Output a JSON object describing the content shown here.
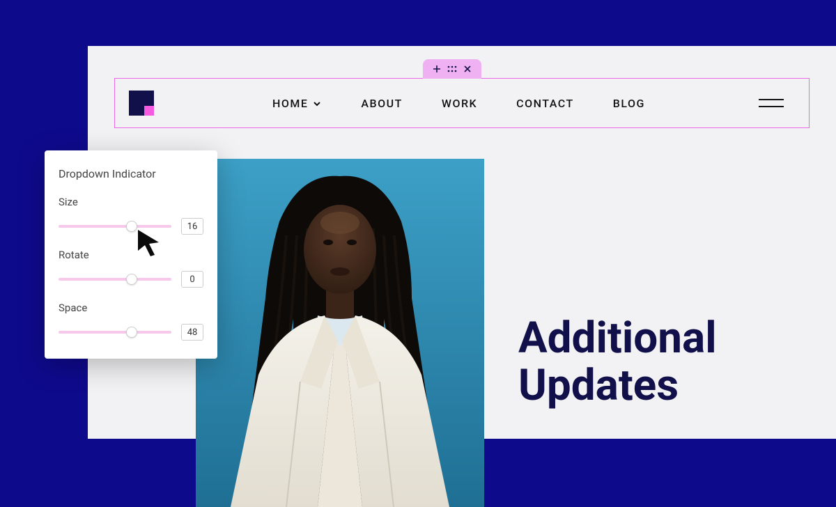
{
  "nav": {
    "items": [
      "HOME",
      "ABOUT",
      "WORK",
      "CONTACT",
      "BLOG"
    ]
  },
  "headline": {
    "line1": "Additional",
    "line2": "Updates"
  },
  "panel": {
    "title": "Dropdown Indicator",
    "controls": [
      {
        "label": "Size",
        "value": "16",
        "pos": 65
      },
      {
        "label": "Rotate",
        "value": "0",
        "pos": 65
      },
      {
        "label": "Space",
        "value": "48",
        "pos": 65
      }
    ]
  },
  "colors": {
    "bg": "#0e0a8c",
    "accent": "#f55be0",
    "ink": "#12104a",
    "tab": "#f0b1f2",
    "sliderTrack": "#f7c8ea"
  }
}
